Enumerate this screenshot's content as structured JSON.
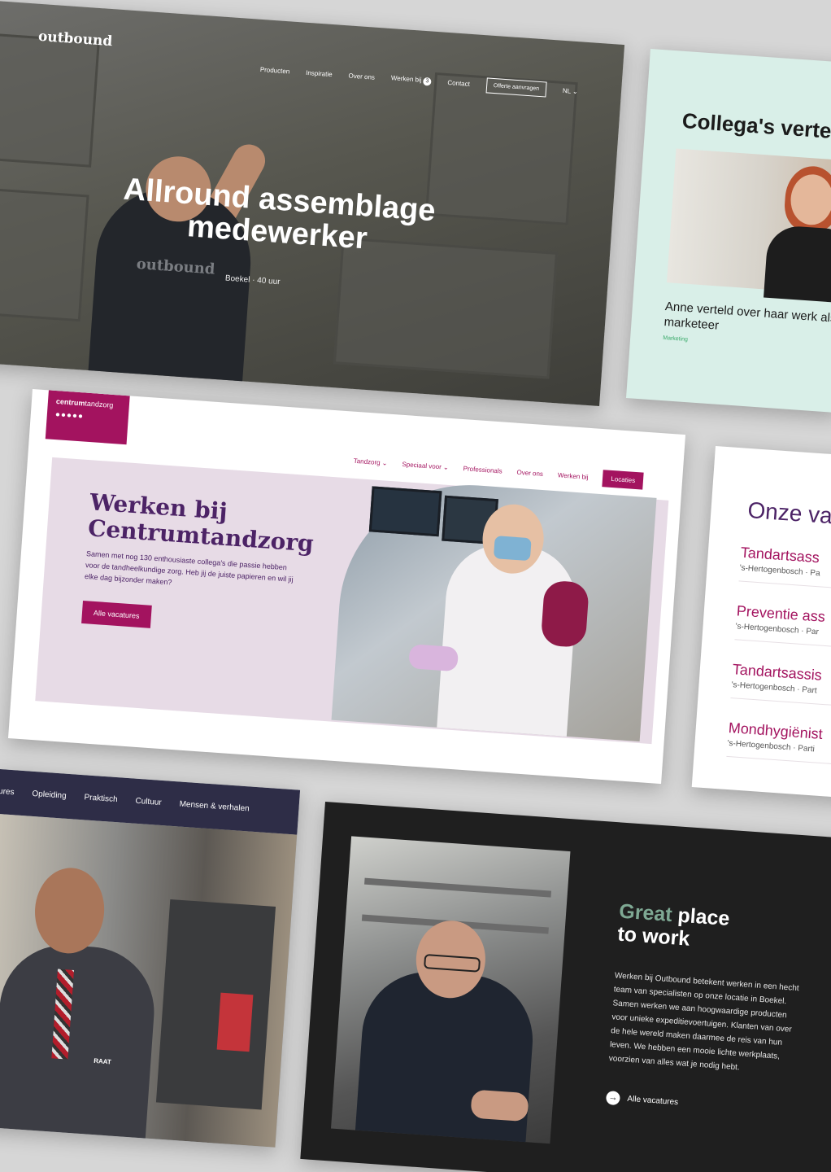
{
  "outbound": {
    "logo": "outbound",
    "nav": [
      "Producten",
      "Inspiratie",
      "Over ons",
      "Werken bij"
    ],
    "nav_badge": "3",
    "contact": "Contact",
    "cta": "Offerte aanvragen",
    "lang": "NL",
    "title_line1": "Allround assemblage",
    "title_line2": "medewerker",
    "subtitle": "Boekel · 40 uur",
    "shirt_logo": "outbound"
  },
  "collega": {
    "title": "Collega's verte",
    "caption": "Anne verteld over haar werk als marketeer",
    "tag": "Marketing"
  },
  "centrum": {
    "logo_bold": "centrum",
    "logo_light": "tandzorg",
    "nav": [
      "Tandzorg ⌄",
      "Speciaal voor ⌄",
      "Professionals",
      "Over ons",
      "Werken bij"
    ],
    "nav_button": "Locaties",
    "heading_line1": "Werken bij",
    "heading_line2": "Centrumtandzorg",
    "paragraph": "Samen met nog 130 enthousiaste collega's die passie hebben voor de tandheelkundige zorg. Heb jij de juiste papieren en wil jij elke dag bijzonder maken?",
    "cta": "Alle vacatures"
  },
  "vacatures": {
    "title": "Onze va",
    "items": [
      {
        "title": "Tandartsass",
        "sub": "'s-Hertogenbosch · Pa"
      },
      {
        "title": "Preventie ass",
        "sub": "'s-Hertogenbosch · Par"
      },
      {
        "title": "Tandartsassis",
        "sub": "'s-Hertogenbosch · Part"
      },
      {
        "title": "Mondhygiënist",
        "sub": "'s-Hertogenbosch · Parti"
      }
    ]
  },
  "mensen": {
    "nav": [
      "ures",
      "Opleiding",
      "Praktisch",
      "Cultuur",
      "Mensen & verhalen"
    ],
    "badge": "RAAT"
  },
  "great": {
    "heading_green": "Great",
    "heading_rest": " place",
    "heading_line2": "to work",
    "paragraph": "Werken bij Outbound betekent werken in een hecht team van specialisten op onze locatie in Boekel. Samen werken we aan hoogwaardige producten voor unieke expeditievoertuigen. Klanten van over de hele wereld maken daarmee de reis van hun leven. We hebben een mooie lichte werkplaats, voorzien van alles wat je nodig hebt.",
    "link": "Alle vacatures"
  }
}
